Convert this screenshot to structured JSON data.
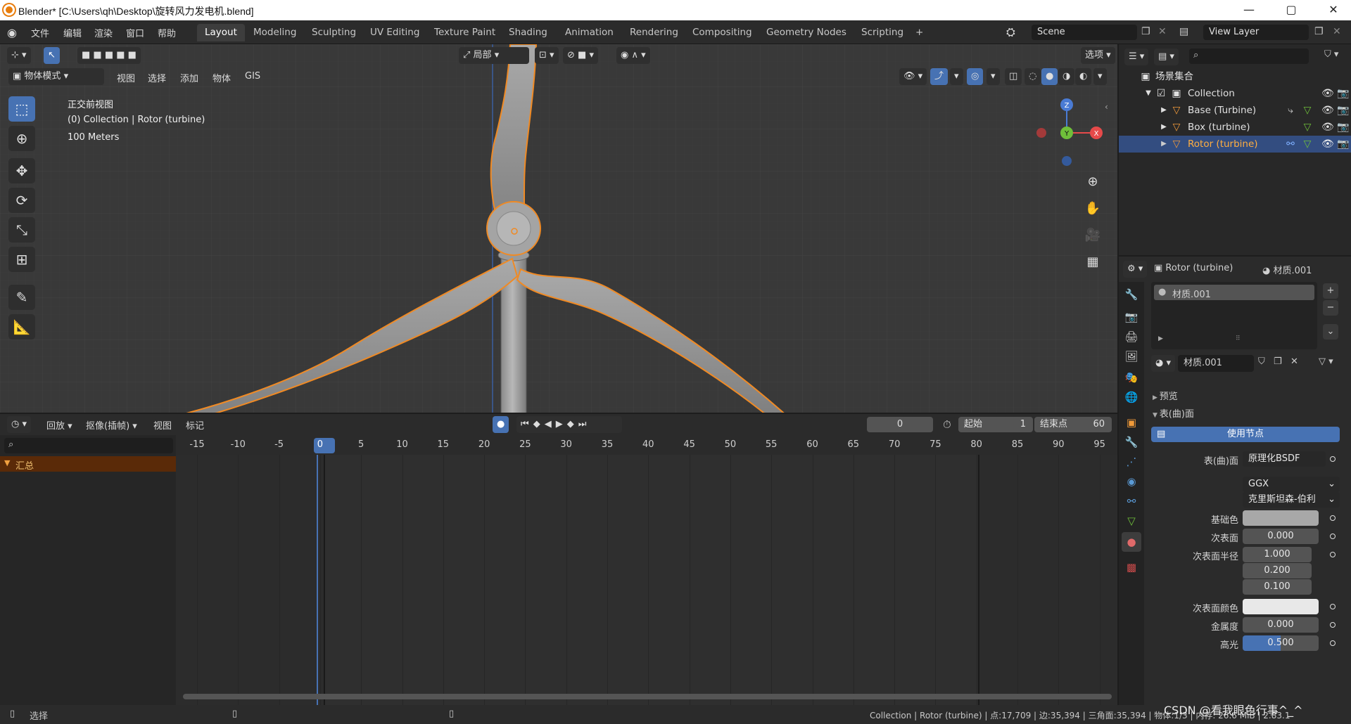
{
  "window": {
    "title": "Blender* [C:\\Users\\qh\\Desktop\\旋转风力发电机.blend]",
    "controls": {
      "minimize": "—",
      "maximize": "▢",
      "close": "✕"
    }
  },
  "menu": [
    "文件",
    "编辑",
    "渲染",
    "窗口",
    "帮助"
  ],
  "workspaces": [
    {
      "label": "Layout",
      "active": true
    },
    {
      "label": "Modeling"
    },
    {
      "label": "Sculpting"
    },
    {
      "label": "UV Editing"
    },
    {
      "label": "Texture Paint"
    },
    {
      "label": "Shading"
    },
    {
      "label": "Animation"
    },
    {
      "label": "Rendering"
    },
    {
      "label": "Compositing"
    },
    {
      "label": "Geometry Nodes"
    },
    {
      "label": "Scripting"
    },
    {
      "label": "+"
    }
  ],
  "scene": {
    "name": "Scene",
    "view_layer": "View Layer"
  },
  "viewport": {
    "mode": "物体模式",
    "menus": [
      "视图",
      "选择",
      "添加",
      "物体",
      "GIS"
    ],
    "transform_orientation": "局部",
    "options": "选项",
    "info": {
      "view": "正交前视图",
      "collection": "(0) Collection | Rotor (turbine)",
      "scale": "100 Meters"
    },
    "gizmo": {
      "z": "Z",
      "y": "Y",
      "x": "X"
    }
  },
  "timeline": {
    "menus": [
      "回放",
      "抠像(插帧)",
      "视图",
      "标记"
    ],
    "current_frame": "0",
    "start_label": "起始",
    "start": "1",
    "end_label": "结束点",
    "end": "60",
    "summary": "汇总",
    "ticks": [
      "-15",
      "-10",
      "-5",
      "0",
      "5",
      "10",
      "15",
      "20",
      "25",
      "30",
      "35",
      "40",
      "45",
      "50",
      "55",
      "60",
      "65",
      "70",
      "75",
      "80",
      "85",
      "90",
      "95"
    ]
  },
  "outliner": {
    "root": "场景集合",
    "items": [
      {
        "label": "Collection"
      },
      {
        "label": "Base (Turbine)"
      },
      {
        "label": "Box (turbine)"
      },
      {
        "label": "Rotor (turbine)",
        "selected": true
      }
    ]
  },
  "properties": {
    "object": "Rotor (turbine)",
    "material": "材质.001",
    "slot": "材质.001",
    "material_field": "材质.001",
    "preview": "预览",
    "surface_section": "表(曲)面",
    "use_nodes": "使用节点",
    "surface_label": "表(曲)面",
    "surface_value": "原理化BSDF",
    "distribution": "GGX",
    "subsurface_method": "克里斯坦森-伯利",
    "rows": [
      {
        "label": "基础色",
        "value": ""
      },
      {
        "label": "次表面",
        "value": "0.000"
      },
      {
        "label": "次表面半径",
        "value": "1.000"
      },
      {
        "label": "",
        "value": "0.200"
      },
      {
        "label": "",
        "value": "0.100"
      },
      {
        "label": "次表面颜色",
        "value": ""
      },
      {
        "label": "金属度",
        "value": "0.000"
      },
      {
        "label": "高光",
        "value": "0.500"
      }
    ]
  },
  "statusbar": {
    "select": "选择",
    "stats": "Collection | Rotor (turbine) | 点:17,709 | 边:35,394 | 三角面:35,394 | 物体:1/3 | 内存: 26.6 MiB | 2.83.1"
  },
  "watermark": "CSDN @看我眼色行事^_^",
  "colors": {
    "accent": "#4772b3",
    "selection_outline": "#f08a24",
    "viewport_bg": "#393939"
  }
}
